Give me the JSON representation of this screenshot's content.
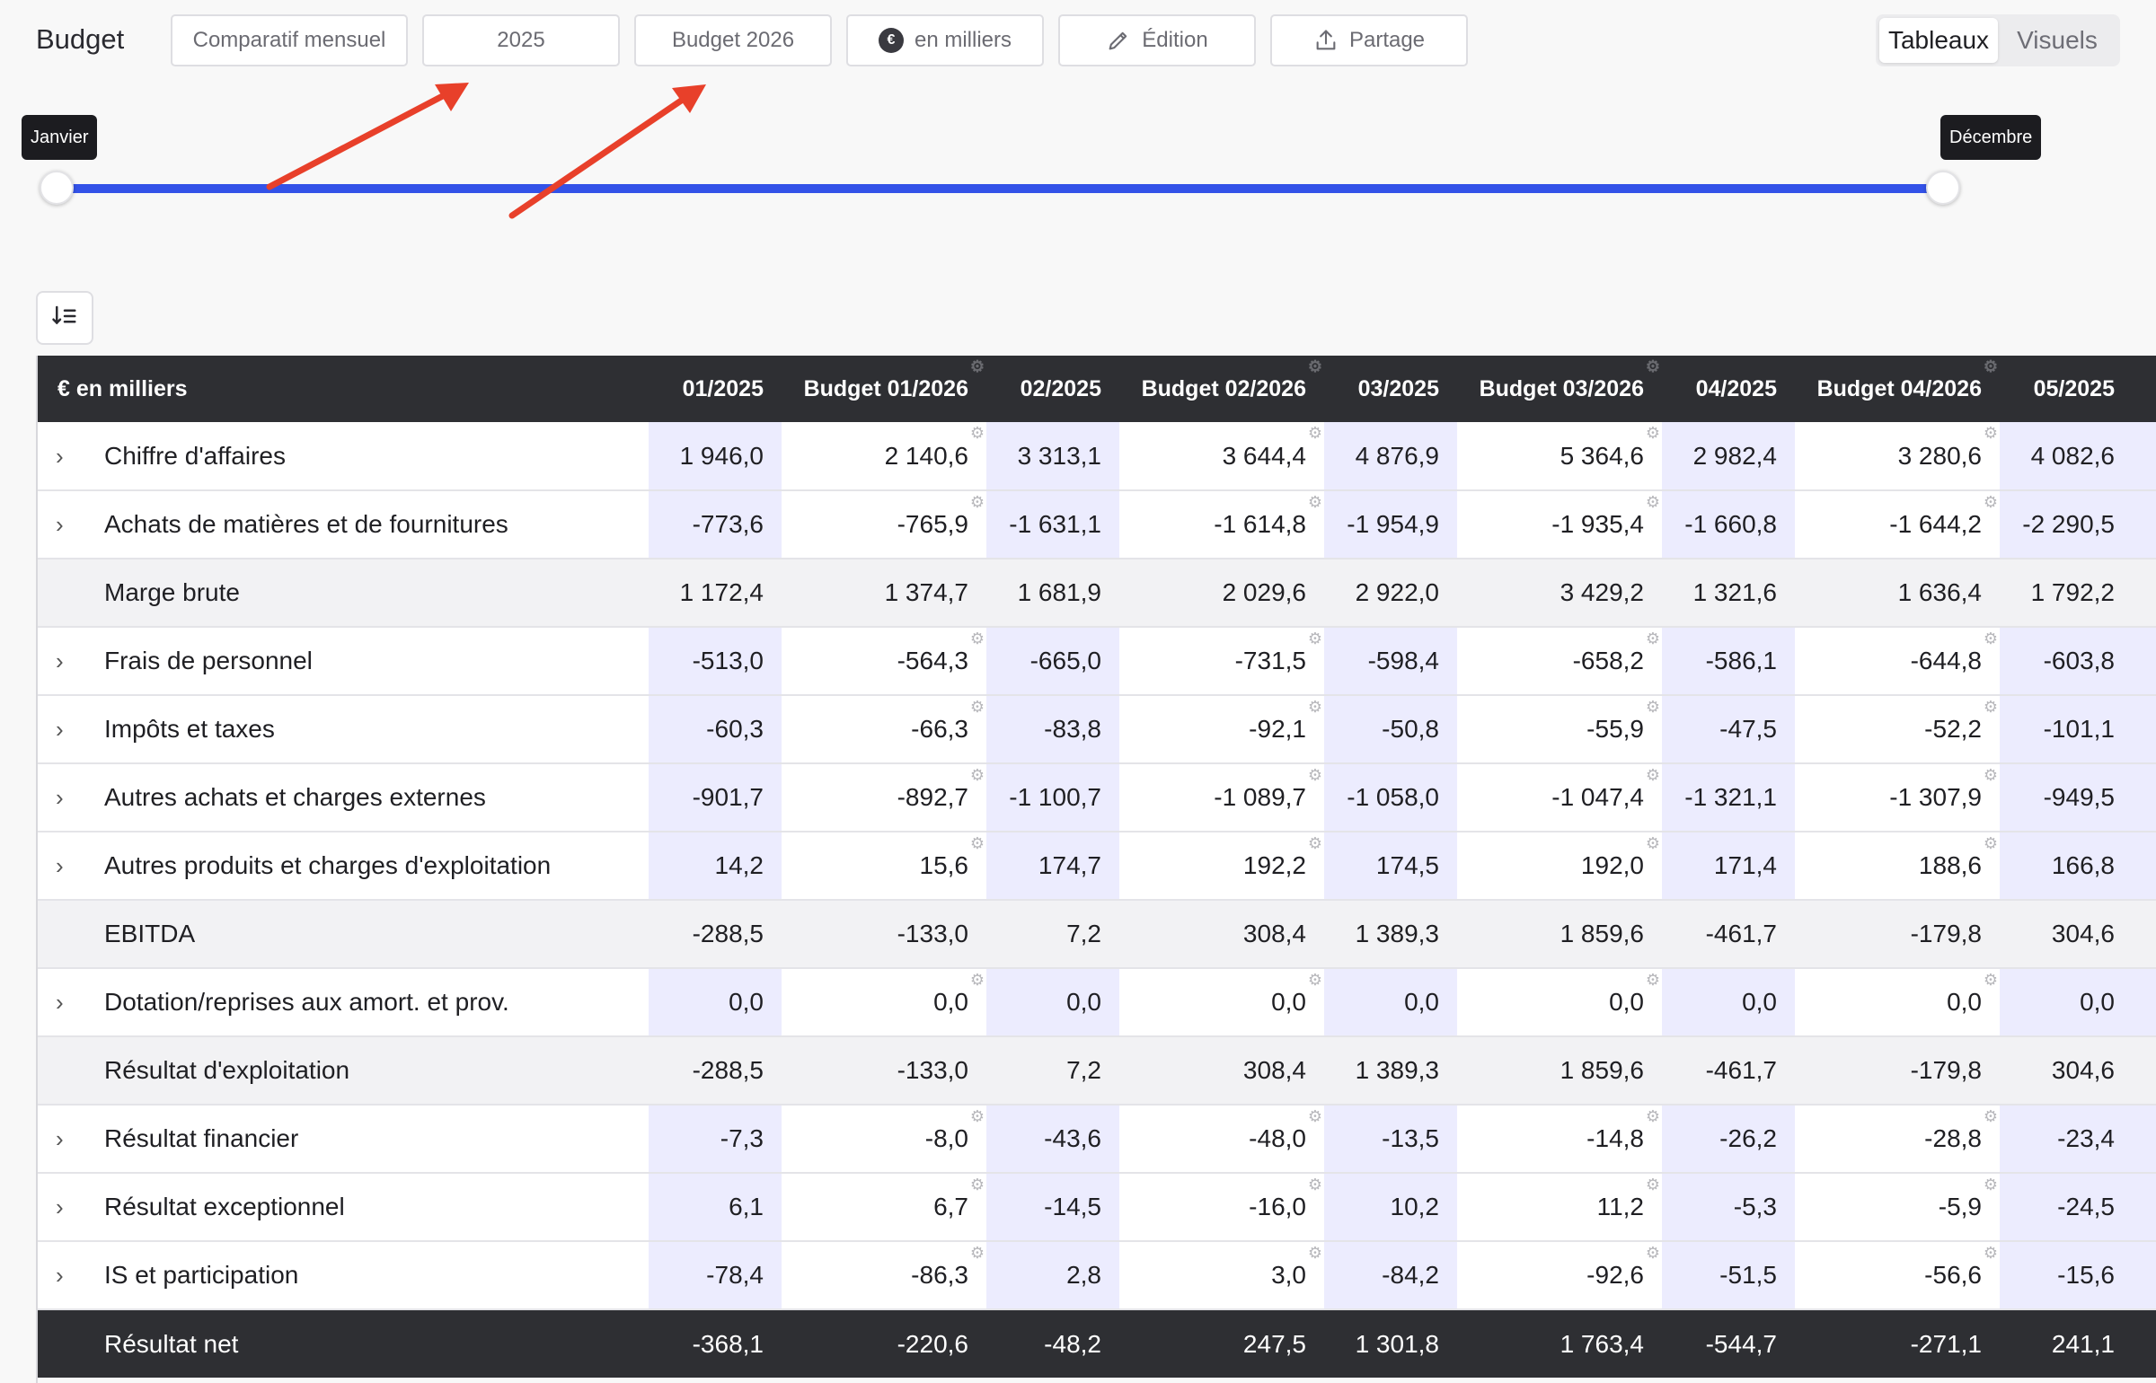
{
  "app": {
    "title": "Budget"
  },
  "toolbar": {
    "comparatif_label": "Comparatif mensuel",
    "year_label": "2025",
    "budget_label": "Budget 2026",
    "currency_symbol": "€",
    "currency_label": "en milliers",
    "edit_label": "Édition",
    "share_label": "Partage"
  },
  "view_toggle": {
    "tables_label": "Tableaux",
    "visuals_label": "Visuels",
    "active": "Tableaux"
  },
  "range_slider": {
    "start_label": "Janvier",
    "end_label": "Décembre",
    "accent_color": "#3352e8"
  },
  "annotation": {
    "arrow_color": "#e8402a"
  },
  "table": {
    "corner_label": "€ en milliers",
    "columns": [
      "01/2025",
      "Budget 01/2026",
      "02/2025",
      "Budget 02/2026",
      "03/2025",
      "Budget 03/2026",
      "04/2025",
      "Budget 04/2026",
      "05/2025"
    ],
    "rows": [
      {
        "label": "Chiffre d'affaires",
        "type": "detail",
        "values": [
          "1 946,0",
          "2 140,6",
          "3 313,1",
          "3 644,4",
          "4 876,9",
          "5 364,6",
          "2 982,4",
          "3 280,6",
          "4 082,6"
        ]
      },
      {
        "label": "Achats de matières et de fournitures",
        "type": "detail",
        "values": [
          "-773,6",
          "-765,9",
          "-1 631,1",
          "-1 614,8",
          "-1 954,9",
          "-1 935,4",
          "-1 660,8",
          "-1 644,2",
          "-2 290,5"
        ]
      },
      {
        "label": "Marge brute",
        "type": "subtotal",
        "values": [
          "1 172,4",
          "1 374,7",
          "1 681,9",
          "2 029,6",
          "2 922,0",
          "3 429,2",
          "1 321,6",
          "1 636,4",
          "1 792,2"
        ]
      },
      {
        "label": "Frais de personnel",
        "type": "detail",
        "values": [
          "-513,0",
          "-564,3",
          "-665,0",
          "-731,5",
          "-598,4",
          "-658,2",
          "-586,1",
          "-644,8",
          "-603,8"
        ]
      },
      {
        "label": "Impôts et taxes",
        "type": "detail",
        "values": [
          "-60,3",
          "-66,3",
          "-83,8",
          "-92,1",
          "-50,8",
          "-55,9",
          "-47,5",
          "-52,2",
          "-101,1"
        ]
      },
      {
        "label": "Autres achats et charges externes",
        "type": "detail",
        "values": [
          "-901,7",
          "-892,7",
          "-1 100,7",
          "-1 089,7",
          "-1 058,0",
          "-1 047,4",
          "-1 321,1",
          "-1 307,9",
          "-949,5"
        ]
      },
      {
        "label": "Autres produits et charges d'exploitation",
        "type": "detail",
        "values": [
          "14,2",
          "15,6",
          "174,7",
          "192,2",
          "174,5",
          "192,0",
          "171,4",
          "188,6",
          "166,8"
        ]
      },
      {
        "label": "EBITDA",
        "type": "subtotal",
        "values": [
          "-288,5",
          "-133,0",
          "7,2",
          "308,4",
          "1 389,3",
          "1 859,6",
          "-461,7",
          "-179,8",
          "304,6"
        ]
      },
      {
        "label": "Dotation/reprises aux amort. et prov.",
        "type": "detail",
        "values": [
          "0,0",
          "0,0",
          "0,0",
          "0,0",
          "0,0",
          "0,0",
          "0,0",
          "0,0",
          "0,0"
        ]
      },
      {
        "label": "Résultat d'exploitation",
        "type": "subtotal",
        "values": [
          "-288,5",
          "-133,0",
          "7,2",
          "308,4",
          "1 389,3",
          "1 859,6",
          "-461,7",
          "-179,8",
          "304,6"
        ]
      },
      {
        "label": "Résultat financier",
        "type": "detail",
        "values": [
          "-7,3",
          "-8,0",
          "-43,6",
          "-48,0",
          "-13,5",
          "-14,8",
          "-26,2",
          "-28,8",
          "-23,4"
        ]
      },
      {
        "label": "Résultat exceptionnel",
        "type": "detail",
        "values": [
          "6,1",
          "6,7",
          "-14,5",
          "-16,0",
          "10,2",
          "11,2",
          "-5,3",
          "-5,9",
          "-24,5"
        ]
      },
      {
        "label": "IS et participation",
        "type": "detail",
        "values": [
          "-78,4",
          "-86,3",
          "2,8",
          "3,0",
          "-84,2",
          "-92,6",
          "-51,5",
          "-56,6",
          "-15,6"
        ]
      },
      {
        "label": "Résultat net",
        "type": "total",
        "values": [
          "-368,1",
          "-220,6",
          "-48,2",
          "247,5",
          "1 301,8",
          "1 763,4",
          "-544,7",
          "-271,1",
          "241,1"
        ]
      }
    ]
  }
}
